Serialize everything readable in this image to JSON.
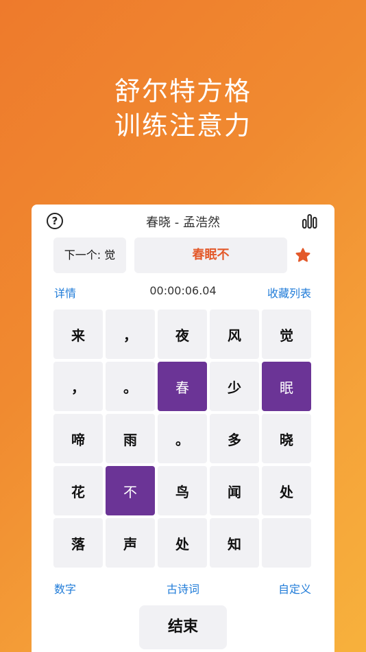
{
  "headline": {
    "line1": "舒尔特方格",
    "line2": "训练注意力"
  },
  "topbar": {
    "help_glyph": "?",
    "title": "春晓 - 孟浩然"
  },
  "next": {
    "label": "下一个: 觉"
  },
  "answer": {
    "text": "春眠不"
  },
  "info": {
    "details_label": "详情",
    "timer": "00:00:06.04",
    "favorites_label": "收藏列表"
  },
  "grid": {
    "rows": [
      [
        {
          "ch": "来",
          "sel": false
        },
        {
          "ch": "，",
          "sel": false
        },
        {
          "ch": "夜",
          "sel": false
        },
        {
          "ch": "风",
          "sel": false
        },
        {
          "ch": "觉",
          "sel": false
        }
      ],
      [
        {
          "ch": "，",
          "sel": false
        },
        {
          "ch": "。",
          "sel": false
        },
        {
          "ch": "春",
          "sel": true
        },
        {
          "ch": "少",
          "sel": false
        },
        {
          "ch": "眠",
          "sel": true
        }
      ],
      [
        {
          "ch": "啼",
          "sel": false
        },
        {
          "ch": "雨",
          "sel": false
        },
        {
          "ch": "。",
          "sel": false
        },
        {
          "ch": "多",
          "sel": false
        },
        {
          "ch": "晓",
          "sel": false
        }
      ],
      [
        {
          "ch": "花",
          "sel": false
        },
        {
          "ch": "不",
          "sel": true
        },
        {
          "ch": "鸟",
          "sel": false
        },
        {
          "ch": "闻",
          "sel": false
        },
        {
          "ch": "处",
          "sel": false
        }
      ],
      [
        {
          "ch": "落",
          "sel": false
        },
        {
          "ch": "声",
          "sel": false
        },
        {
          "ch": "处",
          "sel": false
        },
        {
          "ch": "知",
          "sel": false
        },
        {
          "ch": "",
          "sel": false
        }
      ]
    ]
  },
  "modes": {
    "digits": "数字",
    "poem": "古诗词",
    "custom": "自定义"
  },
  "end_button": {
    "label": "结束"
  },
  "colors": {
    "accent_text": "#e3592a",
    "link": "#1f7bd8",
    "selected_cell": "#6b3496",
    "star": "#e3592a"
  },
  "icons": {
    "help": "question-circle-icon",
    "stats": "bar-chart-icon",
    "favorite": "star-icon"
  }
}
